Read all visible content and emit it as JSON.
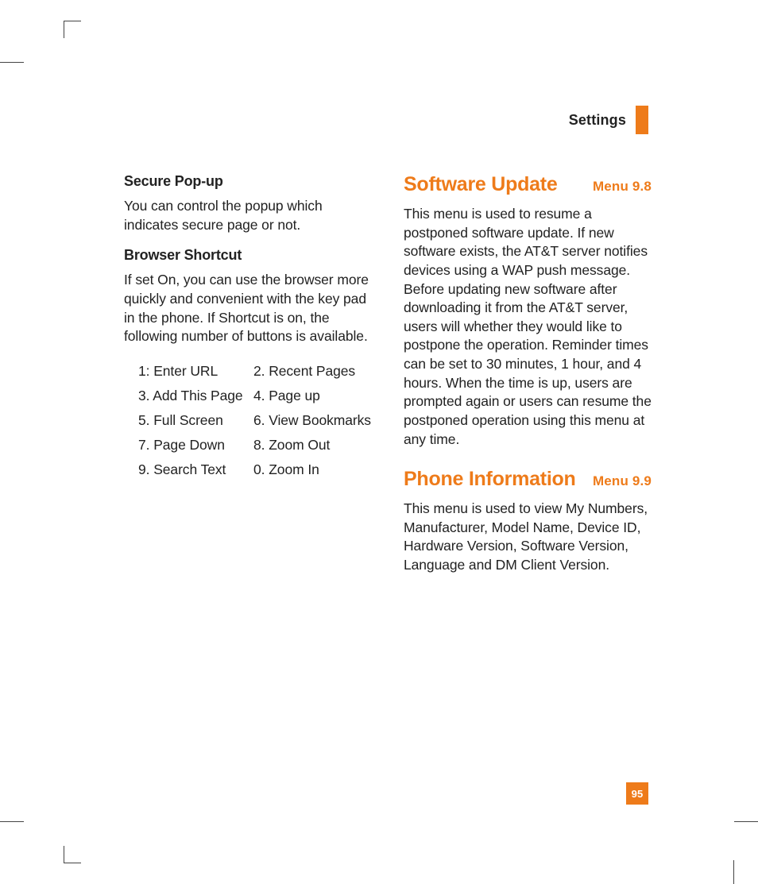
{
  "header": {
    "title": "Settings"
  },
  "left": {
    "secure_popup": {
      "heading": "Secure Pop-up",
      "body": "You can control the popup which indicates secure page or not."
    },
    "browser_shortcut": {
      "heading": "Browser Shortcut",
      "body": "If set On, you can use the browser more quickly and convenient with the key pad in the phone. If Shortcut is on, the following number of buttons is available.",
      "rows": [
        {
          "l": "1: Enter URL",
          "r": "2. Recent Pages"
        },
        {
          "l": "3. Add This Page",
          "r": "4. Page up"
        },
        {
          "l": "5. Full Screen",
          "r": "6. View Bookmarks"
        },
        {
          "l": "7. Page Down",
          "r": "8. Zoom Out"
        },
        {
          "l": "9. Search Text",
          "r": "0. Zoom In"
        }
      ]
    }
  },
  "right": {
    "software_update": {
      "title": "Software Update",
      "menu": "Menu 9.8",
      "body": "This menu is used to resume a postponed software update. If new software exists, the AT&T server notifies devices using a WAP push message. Before updating new software after downloading it from the AT&T server, users will whether they would like to postpone the operation. Reminder times can be set to 30 minutes, 1 hour, and 4 hours. When the time is up, users are prompted again or users can resume the postponed operation using this menu at any time."
    },
    "phone_information": {
      "title": "Phone Information",
      "menu": "Menu 9.9",
      "body": "This menu is used to view My Numbers, Manufacturer, Model Name, Device ID, Hardware Version, Software Version, Language and DM Client Version."
    }
  },
  "page_number": "95"
}
